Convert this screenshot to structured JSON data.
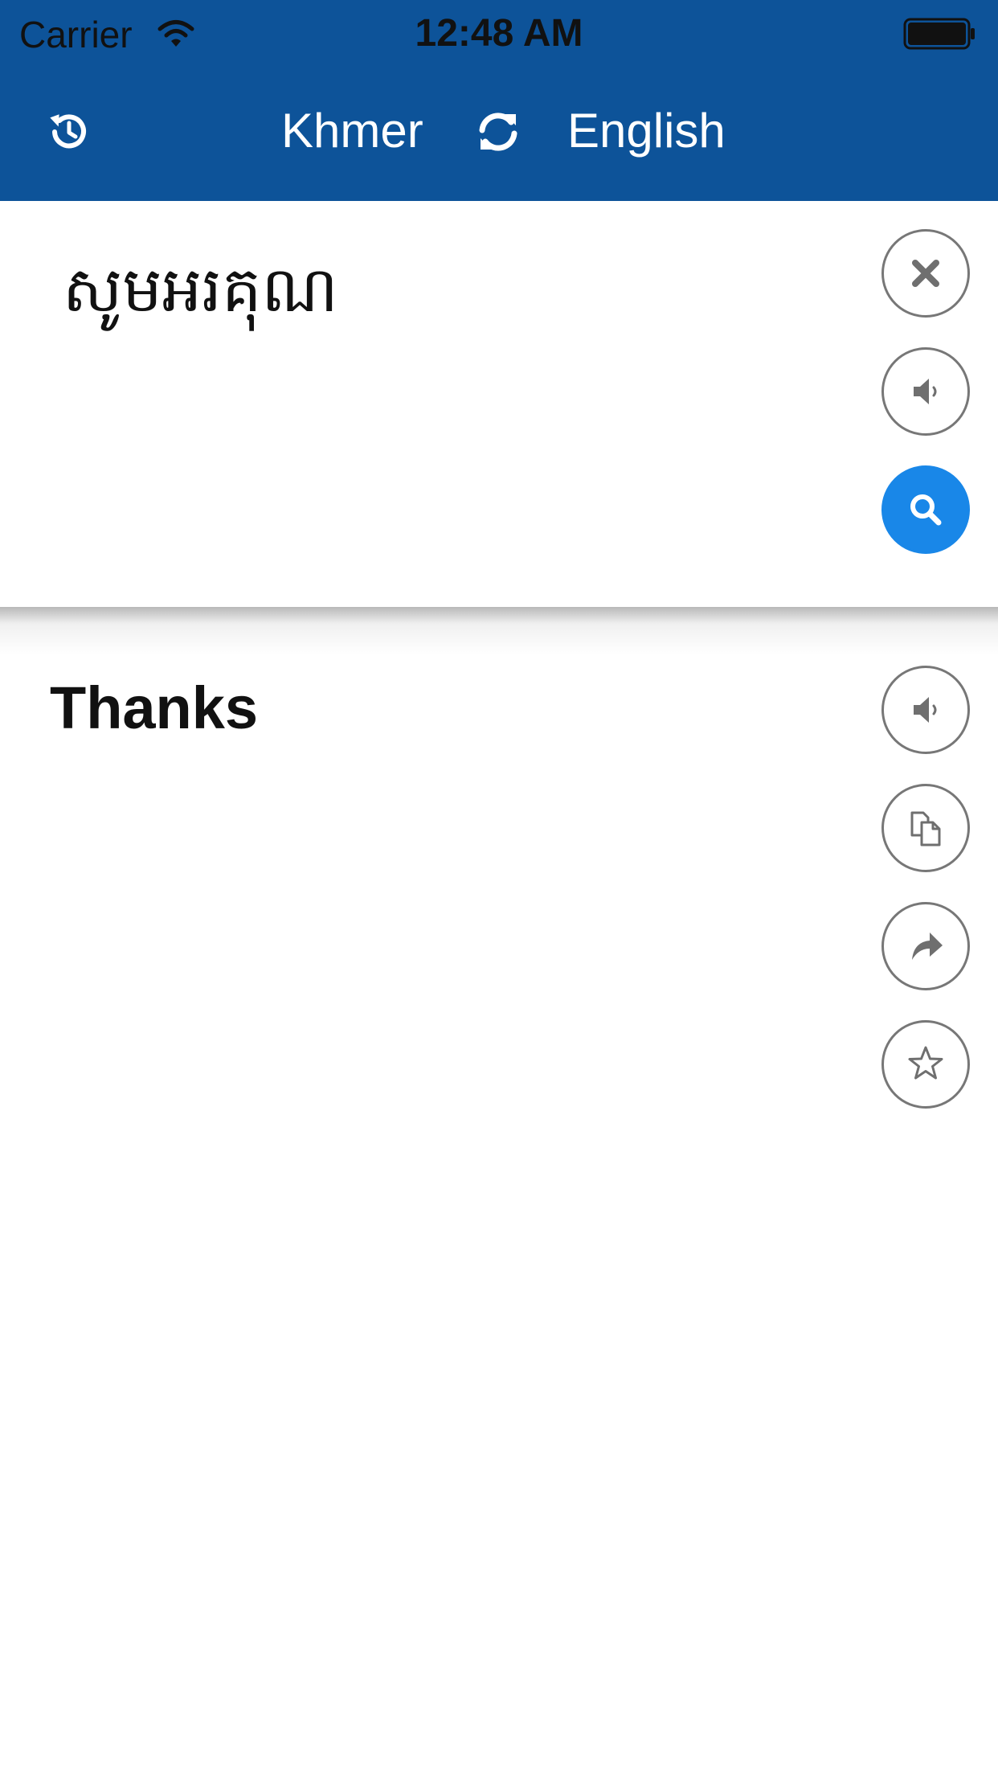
{
  "status_bar": {
    "carrier": "Carrier",
    "time": "12:48 AM"
  },
  "nav": {
    "source_language": "Khmer",
    "target_language": "English",
    "history_icon": "history-icon",
    "swap_icon": "swap-icon"
  },
  "input": {
    "text": "សូមអរគុណ"
  },
  "output": {
    "text": "Thanks"
  },
  "colors": {
    "header_bg": "#0d5399",
    "primary_button": "#1987e8",
    "icon_gray": "#777777"
  },
  "icons": {
    "input_actions": [
      "close-icon",
      "speaker-icon",
      "search-icon"
    ],
    "output_actions": [
      "speaker-icon",
      "copy-icon",
      "share-icon",
      "star-icon"
    ]
  }
}
